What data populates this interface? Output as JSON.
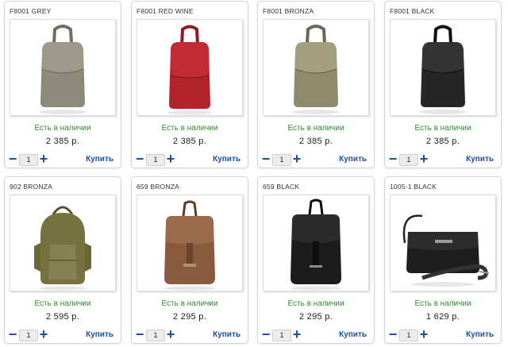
{
  "products": [
    {
      "title": "F8001 GREY",
      "stock": "Есть в наличии",
      "price": "2 385 р.",
      "qty": "1",
      "buy_label": "Купить",
      "minus": "−",
      "plus": "+",
      "icon": "backpack-icon",
      "color": "#8d8a7c"
    },
    {
      "title": "F8001 RED WINE",
      "stock": "Есть в наличии",
      "price": "2 385 р.",
      "qty": "1",
      "buy_label": "Купить",
      "minus": "−",
      "plus": "+",
      "icon": "backpack-icon",
      "color": "#b3232b"
    },
    {
      "title": "F8001 BRONZA",
      "stock": "Есть в наличии",
      "price": "2 385 р.",
      "qty": "1",
      "buy_label": "Купить",
      "minus": "−",
      "plus": "+",
      "icon": "backpack-icon",
      "color": "#8f8a6c"
    },
    {
      "title": "F8001 BLACK",
      "stock": "Есть в наличии",
      "price": "2 385 р.",
      "qty": "1",
      "buy_label": "Купить",
      "minus": "−",
      "plus": "+",
      "icon": "backpack-icon",
      "color": "#262626"
    },
    {
      "title": "902 BRONZA",
      "stock": "Есть в наличии",
      "price": "2 595 р.",
      "qty": "1",
      "buy_label": "Купить",
      "minus": "−",
      "plus": "+",
      "icon": "backpack-icon",
      "color": "#76723f"
    },
    {
      "title": "659 BRONZA",
      "stock": "Есть в наличии",
      "price": "2 295 р.",
      "qty": "1",
      "buy_label": "Купить",
      "minus": "−",
      "plus": "+",
      "icon": "backpack-icon",
      "color": "#8a5a3c"
    },
    {
      "title": "659 BLACK",
      "stock": "Есть в наличии",
      "price": "2 295 р.",
      "qty": "1",
      "buy_label": "Купить",
      "minus": "−",
      "plus": "+",
      "icon": "backpack-icon",
      "color": "#1c1c1c"
    },
    {
      "title": "1005-1 BLACK",
      "stock": "Есть в наличии",
      "price": "1 629 р.",
      "qty": "1",
      "buy_label": "Купить",
      "minus": "−",
      "plus": "+",
      "icon": "shoulder-bag-icon",
      "color": "#1e1e1e"
    }
  ]
}
